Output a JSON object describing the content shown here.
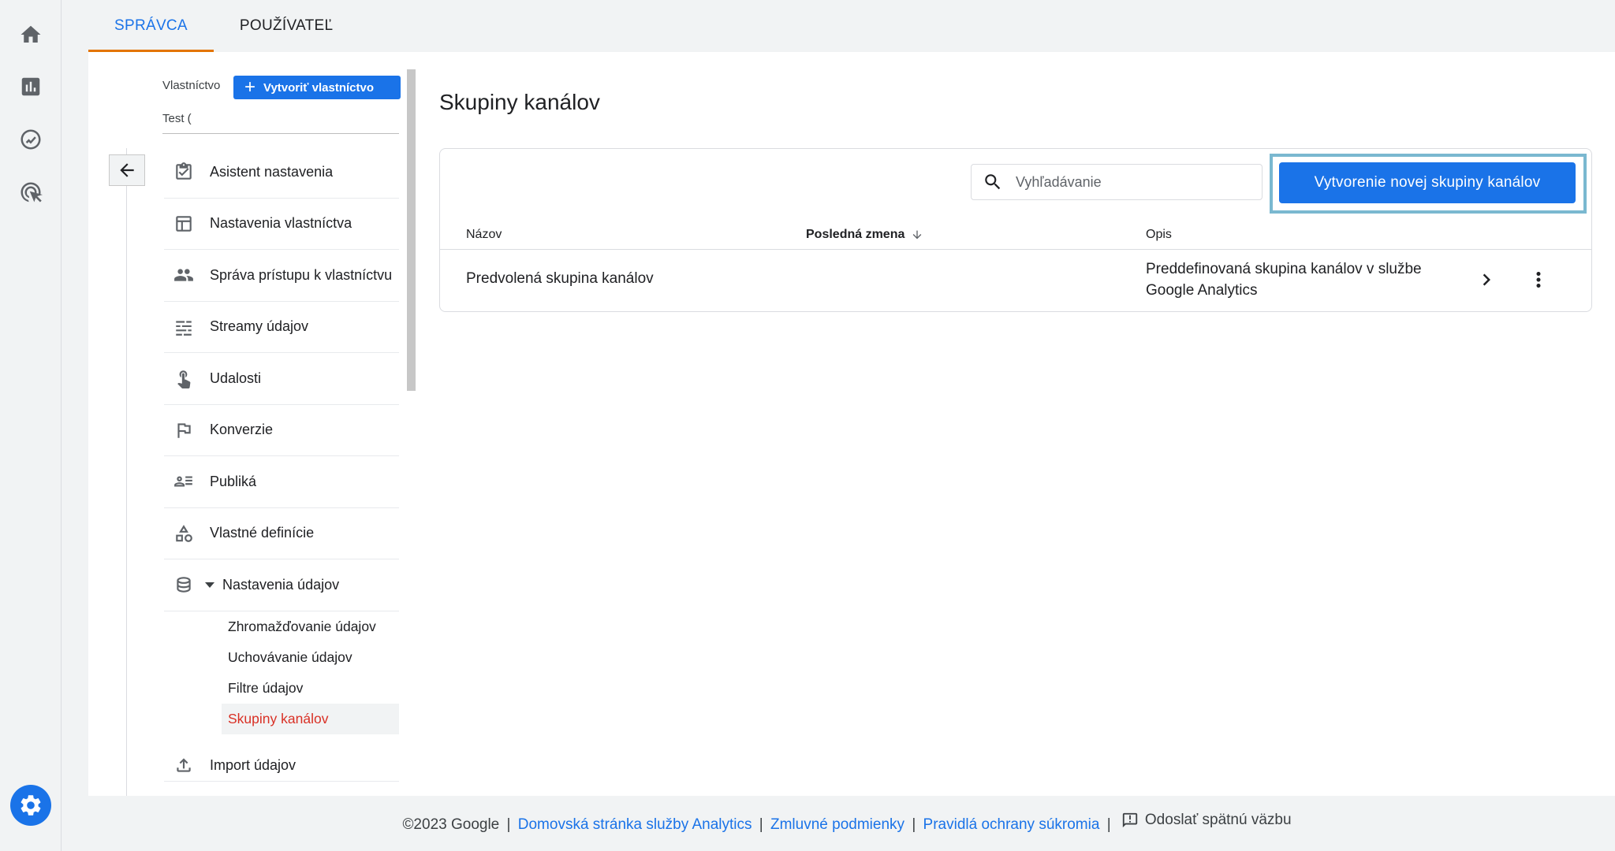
{
  "tabs": [
    {
      "label": "SPRÁVCA",
      "active": true
    },
    {
      "label": "POUŽÍVATEĽ",
      "active": false
    }
  ],
  "rail": {
    "icons": [
      "home-icon",
      "reports-icon",
      "explore-icon",
      "advertising-icon"
    ],
    "settings_icon": "gear-icon"
  },
  "property": {
    "label": "Vlastníctvo",
    "create_label": "Vytvoriť vlastníctvo",
    "value": "Test ("
  },
  "nav": {
    "items": [
      {
        "label": "Asistent nastavenia",
        "icon": "checklist-icon"
      },
      {
        "label": "Nastavenia vlastníctva",
        "icon": "layout-icon"
      },
      {
        "label": "Správa prístupu k vlastníctvu",
        "icon": "people-icon"
      },
      {
        "label": "Streamy údajov",
        "icon": "streams-icon"
      },
      {
        "label": "Udalosti",
        "icon": "touch-icon"
      },
      {
        "label": "Konverzie",
        "icon": "flag-icon"
      },
      {
        "label": "Publiká",
        "icon": "audience-icon"
      },
      {
        "label": "Vlastné definície",
        "icon": "shapes-icon"
      },
      {
        "label": "Nastavenia údajov",
        "icon": "database-icon"
      }
    ],
    "sub_items": [
      {
        "label": "Zhromažďovanie údajov",
        "active": false
      },
      {
        "label": "Uchovávanie údajov",
        "active": false
      },
      {
        "label": "Filtre údajov",
        "active": false
      },
      {
        "label": "Skupiny kanálov",
        "active": true
      }
    ],
    "import_label": "Import údajov"
  },
  "main": {
    "title": "Skupiny kanálov",
    "search_placeholder": "Vyhľadávanie",
    "create_button": "Vytvorenie novej skupiny kanálov",
    "columns": [
      "Názov",
      "Posledná zmena",
      "Opis"
    ],
    "rows": [
      {
        "name": "Predvolená skupina kanálov",
        "last_change": "",
        "description_line1": "Preddefinovaná skupina kanálov v službe",
        "description_line2": "Google Analytics"
      }
    ]
  },
  "footer": {
    "copyright": "©2023 Google",
    "links": [
      "Domovská stránka služby Analytics",
      "Zmluvné podmienky",
      "Pravidlá ochrany súkromia"
    ],
    "feedback": "Odoslať spätnú väzbu"
  },
  "colors": {
    "primary": "#1a73e8",
    "active_tab_underline": "#e37400",
    "active_nav": "#d93025",
    "highlight": "#7ab8d0"
  }
}
